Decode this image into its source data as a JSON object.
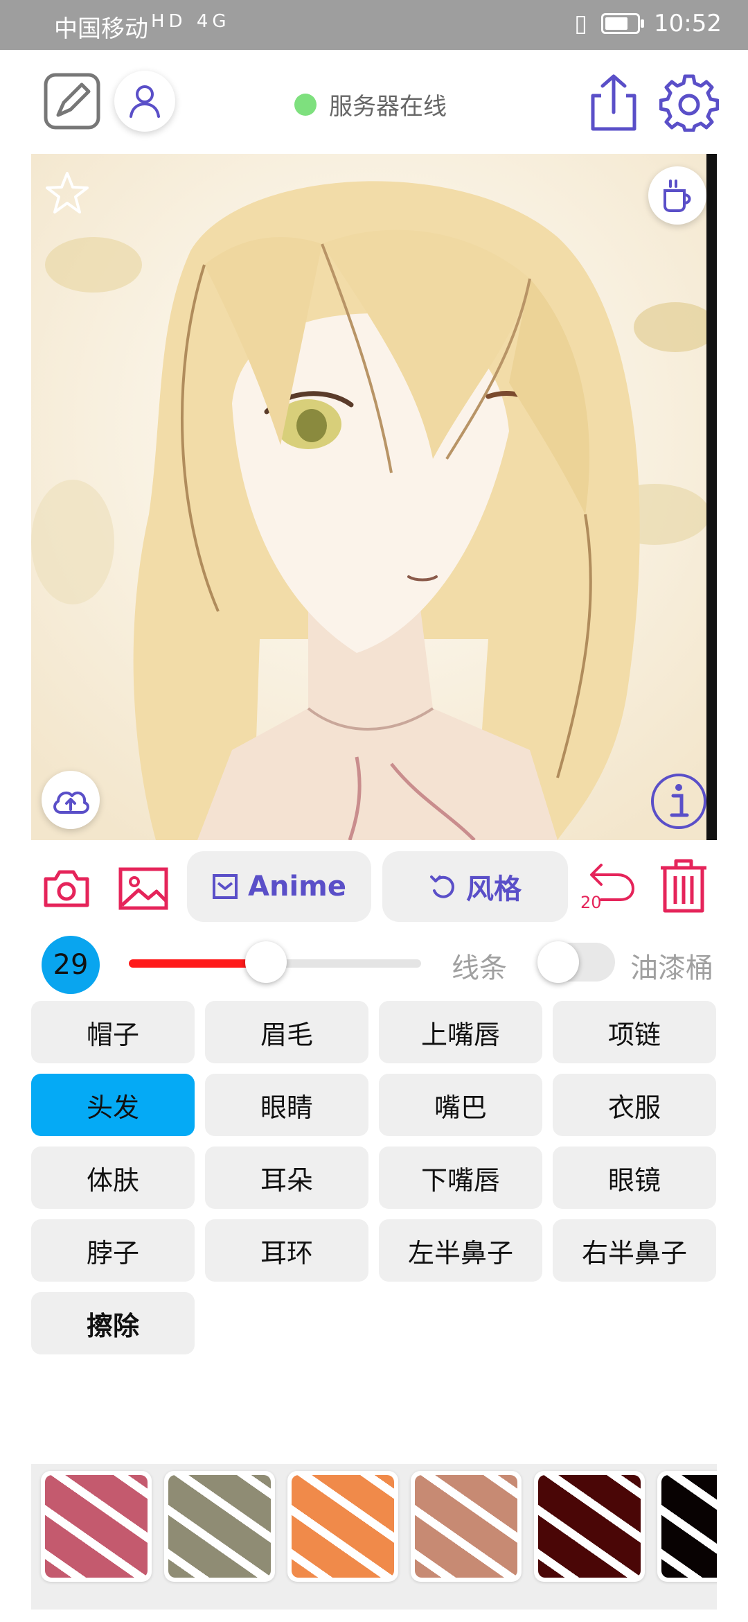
{
  "status_bar": {
    "carrier": "中国移动",
    "network": "HD 4G",
    "time": "10:52"
  },
  "header": {
    "server_status": "服务器在线",
    "server_status_color": "#7ee07e"
  },
  "tools": {
    "anime_label": "Anime",
    "style_label": "风格",
    "undo_count": "20"
  },
  "brush": {
    "size": "29",
    "slider_fraction": 0.47,
    "line_label": "线条",
    "bucket_label": "油漆桶",
    "bucket_toggle_on": false
  },
  "parts": [
    {
      "label": "帽子",
      "active": false
    },
    {
      "label": "眉毛",
      "active": false
    },
    {
      "label": "上嘴唇",
      "active": false
    },
    {
      "label": "项链",
      "active": false
    },
    {
      "label": "头发",
      "active": true
    },
    {
      "label": "眼睛",
      "active": false
    },
    {
      "label": "嘴巴",
      "active": false
    },
    {
      "label": "衣服",
      "active": false
    },
    {
      "label": "体肤",
      "active": false
    },
    {
      "label": "耳朵",
      "active": false
    },
    {
      "label": "下嘴唇",
      "active": false
    },
    {
      "label": "眼镜",
      "active": false
    },
    {
      "label": "脖子",
      "active": false
    },
    {
      "label": "耳环",
      "active": false
    },
    {
      "label": "左半鼻子",
      "active": false
    },
    {
      "label": "右半鼻子",
      "active": false
    },
    {
      "label": "擦除",
      "active": false
    }
  ],
  "colors": {
    "accent_purple": "#5a4fc8",
    "accent_pink": "#e5245a",
    "active_blue": "#05aaf5",
    "slider_red": "#ff1a1a"
  },
  "textures": [
    {
      "name": "texture-1",
      "color": "#c45a6e"
    },
    {
      "name": "texture-2",
      "color": "#8f8c74"
    },
    {
      "name": "texture-3",
      "color": "#f08a4a"
    },
    {
      "name": "texture-4",
      "color": "#c78a73"
    },
    {
      "name": "texture-5",
      "color": "#4a0606"
    },
    {
      "name": "texture-6",
      "color": "#080202"
    }
  ]
}
